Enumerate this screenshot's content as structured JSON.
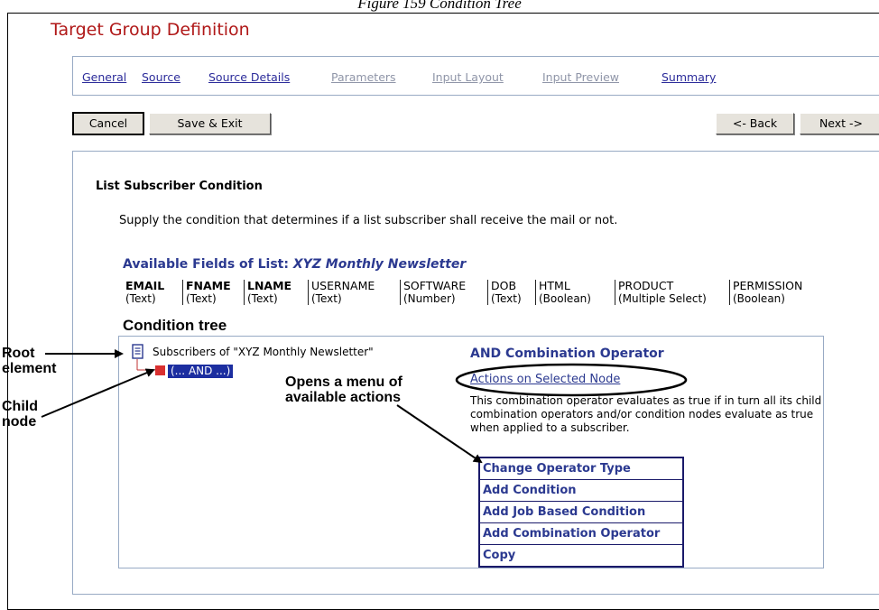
{
  "caption": "Figure 159 Condition Tree",
  "title": "Target Group Definition",
  "tabs": [
    {
      "label": "General",
      "state": "active"
    },
    {
      "label": "Source",
      "state": "active"
    },
    {
      "label": "Source Details",
      "state": "active"
    },
    {
      "label": "Parameters",
      "state": "disabled"
    },
    {
      "label": "Input Layout",
      "state": "disabled"
    },
    {
      "label": "Input Preview",
      "state": "disabled"
    },
    {
      "label": "Summary",
      "state": "active"
    }
  ],
  "buttons": {
    "cancel": "Cancel",
    "save_exit": "Save & Exit",
    "back": "<- Back",
    "next": "Next ->"
  },
  "section": {
    "heading": "List Subscriber Condition",
    "description": "Supply the condition that determines if a list subscriber shall receive the mail or not.",
    "available_prefix": "Available Fields of List: ",
    "available_list": "XYZ Monthly Newsletter"
  },
  "fields": [
    {
      "name": "EMAIL",
      "type": "(Text)"
    },
    {
      "name": "FNAME",
      "type": "(Text)"
    },
    {
      "name": "LNAME",
      "type": "(Text)"
    },
    {
      "name": "USERNAME",
      "type": "(Text)"
    },
    {
      "name": "SOFTWARE",
      "type": "(Number)"
    },
    {
      "name": "DOB",
      "type": "(Text)"
    },
    {
      "name": "HTML",
      "type": "(Boolean)"
    },
    {
      "name": "PRODUCT",
      "type": "(Multiple Select)"
    },
    {
      "name": "PERMISSION",
      "type": "(Boolean)"
    }
  ],
  "tree": {
    "title": "Condition tree",
    "root_label": "Subscribers of \"XYZ Monthly Newsletter\"",
    "child_label": "(... AND ...)"
  },
  "details": {
    "title": "AND Combination Operator",
    "actions_link": "Actions on Selected Node",
    "explanation": "This combination operator evaluates as true if in turn all its child combination operators and/or condition nodes evaluate as true when applied to a subscriber."
  },
  "menu": [
    "Change Operator Type",
    "Add Condition",
    "Add Job Based Condition",
    "Add Combination Operator",
    "Copy"
  ],
  "annotations": {
    "root_element": "Root element",
    "root_line1": "Root",
    "root_line2": "element",
    "child_line1": "Child",
    "child_line2": "node",
    "opens_line1": "Opens a menu of",
    "opens_line2": "available actions"
  },
  "colors": {
    "title": "#b01818",
    "link": "#2b3990",
    "disabled_link": "#8f95a8",
    "selection": "#1c2ea0",
    "child_node_icon": "#d93030"
  }
}
